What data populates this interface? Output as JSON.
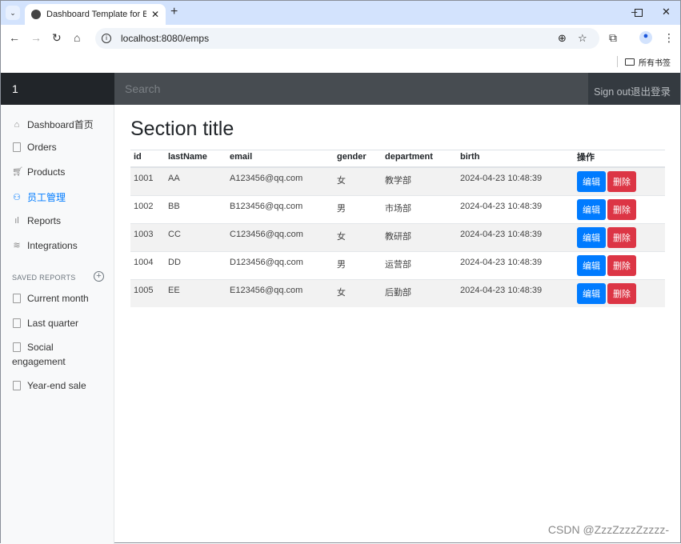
{
  "browser": {
    "tab_title": "Dashboard Template for Boo",
    "url": "localhost:8080/emps",
    "bookmarks_label": "所有书签"
  },
  "navbar": {
    "brand": "1",
    "search_placeholder": "Search",
    "signout": "Sign out退出登录"
  },
  "sidebar": {
    "items": [
      {
        "label": "Dashboard首页",
        "icon": "home-icon"
      },
      {
        "label": "Orders",
        "icon": "file-icon"
      },
      {
        "label": "Products",
        "icon": "cart-icon"
      },
      {
        "label": "员工管理",
        "icon": "users-icon",
        "active": true
      },
      {
        "label": "Reports",
        "icon": "bar-chart-icon"
      },
      {
        "label": "Integrations",
        "icon": "layers-icon"
      }
    ],
    "saved_heading": "SAVED REPORTS",
    "saved": [
      {
        "label": "Current month"
      },
      {
        "label": "Last quarter"
      },
      {
        "label": "Social"
      },
      {
        "label": "engagement"
      },
      {
        "label": "Year-end sale"
      }
    ]
  },
  "main": {
    "title": "Section title",
    "columns": [
      "id",
      "lastName",
      "email",
      "gender",
      "department",
      "birth",
      "操作"
    ],
    "rows": [
      [
        "1001",
        "AA",
        "A123456@qq.com",
        "女",
        "教学部",
        "2024-04-23 10:48:39"
      ],
      [
        "1002",
        "BB",
        "B123456@qq.com",
        "男",
        "市场部",
        "2024-04-23 10:48:39"
      ],
      [
        "1003",
        "CC",
        "C123456@qq.com",
        "女",
        "教研部",
        "2024-04-23 10:48:39"
      ],
      [
        "1004",
        "DD",
        "D123456@qq.com",
        "男",
        "运营部",
        "2024-04-23 10:48:39"
      ],
      [
        "1005",
        "EE",
        "E123456@qq.com",
        "女",
        "后勤部",
        "2024-04-23 10:48:39"
      ]
    ],
    "edit_label": "编辑",
    "delete_label": "删除"
  },
  "watermark": "CSDN @ZzzZzzzZzzzz-",
  "colors": {
    "primary": "#007bff",
    "danger": "#dc3545",
    "navbar": "#343a40"
  }
}
